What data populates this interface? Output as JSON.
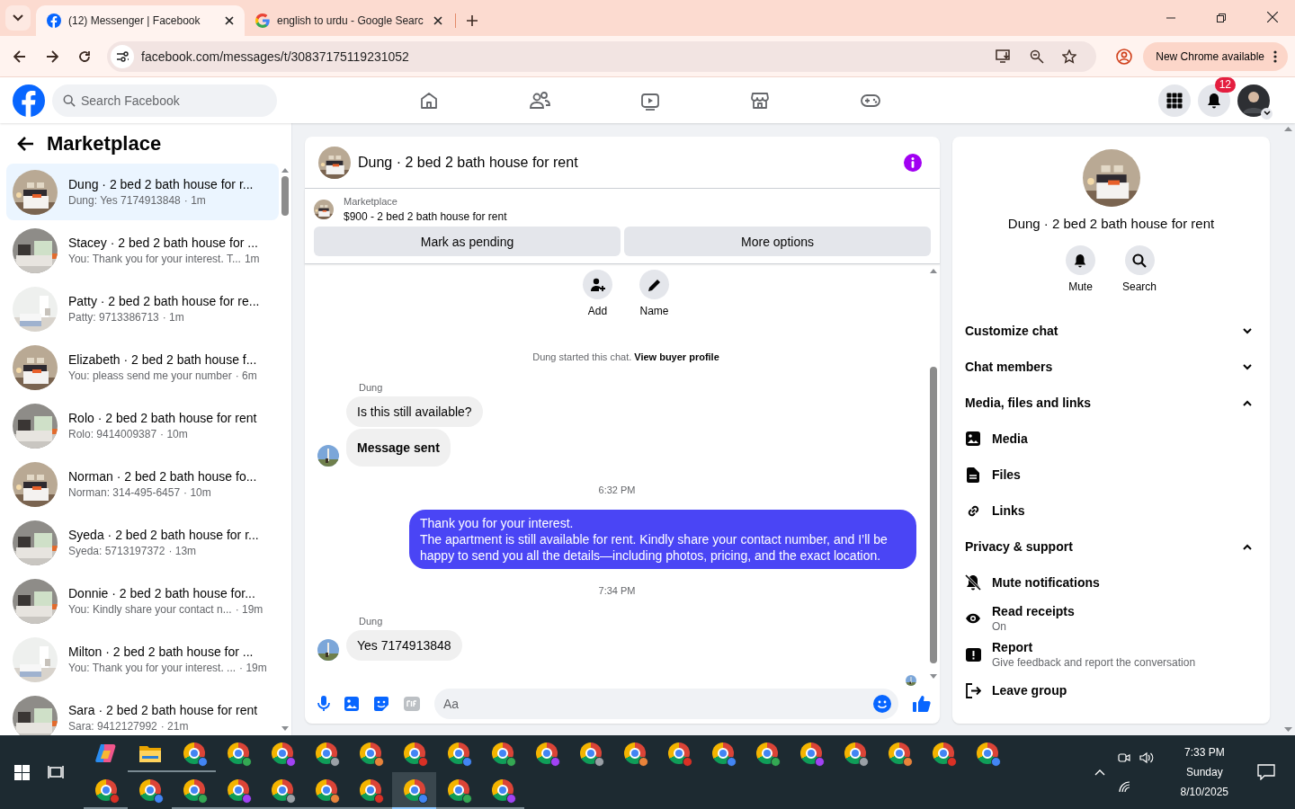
{
  "browser": {
    "tabs": [
      {
        "title": "(12) Messenger | Facebook",
        "kind": "facebook",
        "selected": true
      },
      {
        "title": "english to urdu - Google Searc",
        "kind": "google",
        "selected": false
      }
    ],
    "url": "facebook.com/messages/t/30837175119231052",
    "update_button": "New Chrome available"
  },
  "facebook": {
    "search": {
      "placeholder": "Search Facebook"
    },
    "notifications": "12"
  },
  "sidebar": {
    "title": "Marketplace",
    "conversations": [
      {
        "title": "Dung · 2 bed 2 bath house for r...",
        "preview": "Dung: Yes 7174913848",
        "time": "· 1m",
        "selected": true
      },
      {
        "title": "Stacey · 2 bed 2 bath house for ...",
        "preview": "You: Thank you for your interest. T...",
        "time": "1m",
        "selected": false
      },
      {
        "title": "Patty · 2 bed 2 bath house for re...",
        "preview": "Patty: 9713386713",
        "time": "· 1m",
        "selected": false
      },
      {
        "title": "Elizabeth · 2 bed 2 bath house f...",
        "preview": "You: pleass send me your number",
        "time": "· 6m",
        "selected": false
      },
      {
        "title": "Rolo · 2 bed 2 bath house for rent",
        "preview": "Rolo: 9414009387",
        "time": "· 10m",
        "selected": false
      },
      {
        "title": "Norman · 2 bed 2 bath house fo...",
        "preview": "Norman: 314-495-6457",
        "time": "· 10m",
        "selected": false
      },
      {
        "title": "Syeda · 2 bed 2 bath house for r...",
        "preview": "Syeda: 5713197372",
        "time": "· 13m",
        "selected": false
      },
      {
        "title": "Donnie · 2 bed 2 bath house for...",
        "preview": "You: Kindly share your contact n...",
        "time": "· 19m",
        "selected": false
      },
      {
        "title": "Milton · 2 bed 2 bath house for ...",
        "preview": "You: Thank you for your interest. ...",
        "time": "· 19m",
        "selected": false
      },
      {
        "title": "Sara · 2 bed 2 bath house for rent",
        "preview": "Sara: 9412127992",
        "time": "· 21m",
        "selected": false
      }
    ]
  },
  "chat": {
    "title": "Dung · 2 bed 2 bath house for rent",
    "listing": {
      "label": "Marketplace",
      "title": "$900 - 2 bed 2 bath house for rent"
    },
    "buttons": [
      "Mark as pending",
      "More options"
    ],
    "actions": [
      {
        "label": "Add",
        "kind": "add"
      },
      {
        "label": "Name",
        "kind": "name"
      }
    ],
    "notice": "Dung started this chat.",
    "notice_link": "View buyer profile",
    "messages": [
      {
        "kind": "sender",
        "text": "Dung"
      },
      {
        "kind": "incoming",
        "text": "Is this still available?",
        "bold": false,
        "avatar": false
      },
      {
        "kind": "incoming",
        "text": "Message sent",
        "bold": true,
        "avatar": true
      },
      {
        "kind": "time",
        "text": "6:32 PM"
      },
      {
        "kind": "outgoing",
        "text": "Thank you for your interest.\nThe apartment is still available for rent. Kindly share your contact number, and I’ll be happy to send you all the details—including photos, pricing, and the exact location."
      },
      {
        "kind": "time",
        "text": "7:34 PM"
      },
      {
        "kind": "sender",
        "text": "Dung"
      },
      {
        "kind": "incoming",
        "text": "Yes 7174913848",
        "bold": false,
        "avatar": true
      }
    ],
    "composer": {
      "placeholder": "Aa"
    }
  },
  "info": {
    "title": "Dung · 2 bed 2 bath house for rent",
    "actions": [
      {
        "label": "Mute",
        "kind": "mute"
      },
      {
        "label": "Search",
        "kind": "search"
      }
    ],
    "sections": [
      {
        "title": "Customize chat",
        "expanded": false
      },
      {
        "title": "Chat members",
        "expanded": false
      },
      {
        "title": "Media, files and links",
        "expanded": true,
        "items": [
          {
            "label": "Media",
            "kind": "media"
          },
          {
            "label": "Files",
            "kind": "files"
          },
          {
            "label": "Links",
            "kind": "links"
          }
        ]
      },
      {
        "title": "Privacy & support",
        "expanded": true,
        "items": [
          {
            "label": "Mute notifications",
            "kind": "mute"
          },
          {
            "label": "Read receipts",
            "sub": "On",
            "kind": "eye"
          },
          {
            "label": "Report",
            "sub": "Give feedback and report the conversation",
            "kind": "report"
          },
          {
            "label": "Leave group",
            "kind": "leave"
          }
        ]
      }
    ]
  },
  "taskbar": {
    "rows": [
      [
        {
          "kind": "copilot",
          "running": false,
          "selected": false
        },
        {
          "kind": "explorer",
          "running": true,
          "selected": false
        },
        {
          "kind": "chrome",
          "running": true,
          "selected": false
        },
        {
          "kind": "chrome",
          "running": false,
          "selected": false
        },
        {
          "kind": "chrome",
          "running": false,
          "selected": false
        },
        {
          "kind": "chrome",
          "running": false,
          "selected": false
        },
        {
          "kind": "chrome",
          "running": false,
          "selected": false
        },
        {
          "kind": "chrome",
          "running": false,
          "selected": false
        },
        {
          "kind": "chrome",
          "running": false,
          "selected": false
        },
        {
          "kind": "chrome",
          "running": false,
          "selected": false
        },
        {
          "kind": "chrome",
          "running": false,
          "selected": false
        },
        {
          "kind": "chrome",
          "running": false,
          "selected": false
        },
        {
          "kind": "chrome",
          "running": false,
          "selected": false
        },
        {
          "kind": "chrome",
          "running": false,
          "selected": false
        },
        {
          "kind": "chrome",
          "running": false,
          "selected": false
        },
        {
          "kind": "chrome",
          "running": false,
          "selected": false
        },
        {
          "kind": "chrome",
          "running": false,
          "selected": false
        },
        {
          "kind": "chrome",
          "running": false,
          "selected": false
        },
        {
          "kind": "chrome",
          "running": false,
          "selected": false
        },
        {
          "kind": "chrome",
          "running": false,
          "selected": false
        },
        {
          "kind": "chrome",
          "running": false,
          "selected": false
        }
      ],
      [
        {
          "kind": "chrome",
          "running": true,
          "selected": false
        },
        {
          "kind": "chrome",
          "running": false,
          "selected": false
        },
        {
          "kind": "chrome",
          "running": true,
          "selected": false
        },
        {
          "kind": "chrome",
          "running": true,
          "selected": false
        },
        {
          "kind": "chrome",
          "running": true,
          "selected": false
        },
        {
          "kind": "chrome",
          "running": true,
          "selected": false
        },
        {
          "kind": "chrome",
          "running": true,
          "selected": false
        },
        {
          "kind": "chrome",
          "running": true,
          "selected": true
        },
        {
          "kind": "chrome",
          "running": true,
          "selected": false
        },
        {
          "kind": "chrome",
          "running": true,
          "selected": false
        }
      ]
    ],
    "time": "7:33 PM",
    "day": "Sunday",
    "date": "8/10/2025"
  }
}
